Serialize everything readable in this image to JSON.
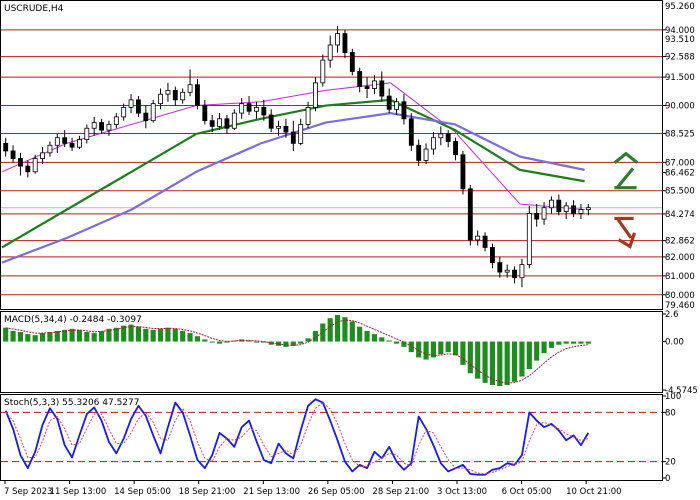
{
  "chart_data": [
    {
      "type": "candlestick",
      "title": "USCRUDE,H4",
      "x_tick_labels": [
        "7 Sep 2023",
        "11 Sep 13:00",
        "14 Sep 05:00",
        "18 Sep 21:00",
        "21 Sep 13:00",
        "26 Sep 05:00",
        "28 Sep 21:00",
        "3 Oct 13:00",
        "6 Oct 05:00",
        "10 Oct 21:00"
      ],
      "y_tick_labels": [
        "95.260",
        "93.510",
        "79.460"
      ],
      "ylim": [
        79.46,
        95.26
      ],
      "levels": [
        {
          "label": "94.000",
          "value": 94.0
        },
        {
          "label": "92.588",
          "value": 92.588
        },
        {
          "label": "91.500",
          "value": 91.5
        },
        {
          "label": "90.000",
          "value": 90.0
        },
        {
          "label": "88.525",
          "value": 88.525
        },
        {
          "label": "87.000",
          "value": 87.0
        },
        {
          "label": "86.462",
          "value": 86.462
        },
        {
          "label": "85.500",
          "value": 85.5
        },
        {
          "label": "84.274",
          "value": 84.274
        },
        {
          "label": "82.862",
          "value": 82.862
        },
        {
          "label": "82.000",
          "value": 82.0
        },
        {
          "label": "81.000",
          "value": 81.0
        },
        {
          "label": "80.000",
          "value": 80.0
        }
      ],
      "current_price": 84.6,
      "candles_ohlc": [
        [
          88.0,
          88.3,
          87.3,
          87.6
        ],
        [
          87.6,
          87.9,
          87.0,
          87.2
        ],
        [
          87.2,
          87.5,
          86.3,
          86.8
        ],
        [
          86.8,
          87.1,
          86.2,
          86.5
        ],
        [
          86.5,
          87.4,
          86.4,
          87.2
        ],
        [
          87.2,
          87.8,
          86.9,
          87.5
        ],
        [
          87.5,
          88.1,
          87.3,
          87.9
        ],
        [
          87.9,
          88.5,
          87.5,
          88.3
        ],
        [
          88.3,
          88.7,
          87.8,
          88.0
        ],
        [
          88.0,
          88.3,
          87.6,
          87.8
        ],
        [
          87.8,
          88.4,
          87.7,
          88.2
        ],
        [
          88.2,
          89.0,
          88.0,
          88.8
        ],
        [
          88.8,
          89.4,
          88.4,
          89.1
        ],
        [
          89.1,
          89.3,
          88.5,
          88.7
        ],
        [
          88.7,
          89.2,
          88.4,
          89.0
        ],
        [
          89.0,
          89.6,
          88.8,
          89.4
        ],
        [
          89.4,
          90.1,
          89.2,
          89.9
        ],
        [
          89.9,
          90.6,
          89.6,
          90.3
        ],
        [
          90.3,
          90.5,
          89.4,
          89.6
        ],
        [
          89.6,
          90.0,
          88.8,
          89.2
        ],
        [
          89.2,
          90.3,
          89.1,
          90.1
        ],
        [
          90.1,
          90.9,
          89.8,
          90.6
        ],
        [
          90.6,
          91.2,
          90.2,
          90.8
        ],
        [
          90.8,
          91.0,
          90.0,
          90.3
        ],
        [
          90.3,
          90.9,
          90.1,
          90.7
        ],
        [
          90.7,
          91.9,
          90.5,
          91.1
        ],
        [
          91.1,
          91.4,
          89.8,
          90.0
        ],
        [
          90.0,
          90.3,
          89.0,
          89.2
        ],
        [
          89.2,
          89.5,
          88.6,
          88.9
        ],
        [
          88.9,
          89.6,
          88.7,
          89.3
        ],
        [
          89.3,
          89.5,
          88.5,
          88.8
        ],
        [
          88.8,
          89.8,
          88.7,
          89.6
        ],
        [
          89.6,
          90.4,
          89.3,
          90.1
        ],
        [
          90.1,
          90.5,
          89.5,
          89.7
        ],
        [
          89.7,
          90.2,
          89.3,
          89.9
        ],
        [
          89.9,
          90.3,
          89.2,
          89.5
        ],
        [
          89.5,
          89.8,
          88.6,
          88.8
        ],
        [
          88.8,
          89.2,
          88.4,
          88.9
        ],
        [
          88.9,
          89.3,
          88.3,
          88.6
        ],
        [
          88.6,
          89.2,
          87.6,
          88.0
        ],
        [
          88.0,
          89.3,
          87.9,
          89.0
        ],
        [
          89.0,
          90.2,
          88.8,
          89.9
        ],
        [
          89.9,
          91.5,
          89.7,
          91.2
        ],
        [
          91.2,
          92.7,
          91.0,
          92.4
        ],
        [
          92.4,
          93.7,
          92.0,
          93.2
        ],
        [
          93.2,
          94.2,
          92.8,
          93.8
        ],
        [
          93.8,
          94.0,
          92.5,
          92.8
        ],
        [
          92.8,
          93.0,
          91.6,
          91.8
        ],
        [
          91.8,
          92.0,
          90.7,
          91.0
        ],
        [
          91.0,
          91.5,
          90.4,
          90.9
        ],
        [
          90.9,
          91.6,
          90.6,
          91.3
        ],
        [
          91.3,
          91.8,
          90.2,
          90.5
        ],
        [
          90.5,
          90.9,
          89.6,
          89.8
        ],
        [
          89.8,
          90.4,
          89.5,
          90.2
        ],
        [
          90.2,
          90.6,
          89.0,
          89.3
        ],
        [
          89.3,
          89.6,
          87.6,
          87.9
        ],
        [
          87.9,
          88.2,
          86.8,
          87.1
        ],
        [
          87.1,
          88.0,
          86.9,
          87.7
        ],
        [
          87.7,
          88.6,
          87.4,
          88.3
        ],
        [
          88.3,
          88.9,
          87.9,
          88.5
        ],
        [
          88.5,
          88.7,
          87.8,
          88.1
        ],
        [
          88.1,
          88.3,
          87.1,
          87.4
        ],
        [
          87.4,
          87.6,
          85.3,
          85.6
        ],
        [
          85.6,
          85.8,
          82.6,
          82.9
        ],
        [
          82.9,
          83.4,
          82.6,
          83.1
        ],
        [
          83.1,
          83.3,
          82.3,
          82.5
        ],
        [
          82.5,
          82.7,
          81.4,
          81.7
        ],
        [
          81.7,
          82.0,
          80.9,
          81.2
        ],
        [
          81.2,
          81.6,
          80.9,
          81.3
        ],
        [
          81.3,
          81.5,
          80.6,
          80.9
        ],
        [
          80.9,
          81.9,
          80.4,
          81.6
        ],
        [
          81.6,
          84.7,
          81.4,
          84.3
        ],
        [
          84.3,
          84.8,
          83.6,
          84.0
        ],
        [
          84.0,
          84.9,
          83.7,
          84.6
        ],
        [
          84.6,
          85.2,
          84.3,
          85.0
        ],
        [
          85.0,
          85.3,
          84.2,
          84.4
        ],
        [
          84.4,
          84.9,
          84.0,
          84.7
        ],
        [
          84.7,
          85.0,
          84.1,
          84.3
        ],
        [
          84.3,
          84.8,
          84.0,
          84.5
        ],
        [
          84.5,
          84.8,
          84.2,
          84.6
        ]
      ],
      "moving_averages": [
        {
          "color": "#c42bd9",
          "values_at_x_ticks": [
            86.5,
            88.0,
            89.0,
            90.0,
            90.2,
            90.8,
            91.2,
            88.6,
            84.8,
            84.5
          ]
        },
        {
          "color": "#1f7d1f",
          "values_at_x_ticks": [
            82.5,
            84.5,
            86.5,
            88.5,
            89.3,
            90.0,
            90.3,
            88.7,
            86.6,
            86.0
          ]
        },
        {
          "color": "#7b6fd6",
          "values_at_x_ticks": [
            81.7,
            83.0,
            84.5,
            86.5,
            88.0,
            89.1,
            89.6,
            89.0,
            87.3,
            86.6
          ]
        }
      ],
      "annotations": [
        {
          "label": "up-arrow",
          "color": "#2e7d32",
          "value": 86.4
        },
        {
          "label": "down-arrow",
          "color": "#a0391f",
          "value": 83.4
        }
      ]
    },
    {
      "type": "histogram",
      "title": "MACD(5,34,4) -0.2484 -0.3097",
      "y_tick_labels": [
        "2.6",
        "0.00",
        "-4.5745"
      ],
      "ylim": [
        -4.5745,
        2.6
      ],
      "bars": [
        1.3,
        1.0,
        0.9,
        0.7,
        0.6,
        0.8,
        0.9,
        1.0,
        1.1,
        1.2,
        1.1,
        0.9,
        0.8,
        1.0,
        1.2,
        1.3,
        1.5,
        1.6,
        1.4,
        1.2,
        1.1,
        1.2,
        1.3,
        1.2,
        1.0,
        0.8,
        0.5,
        0.2,
        -0.1,
        -0.2,
        -0.1,
        0.1,
        0.2,
        0.1,
        0.0,
        -0.1,
        -0.3,
        -0.4,
        -0.5,
        -0.4,
        -0.2,
        0.3,
        1.0,
        1.7,
        2.2,
        2.5,
        2.3,
        1.9,
        1.4,
        1.0,
        0.7,
        0.4,
        0.1,
        -0.2,
        -0.5,
        -1.0,
        -1.5,
        -1.7,
        -1.5,
        -1.2,
        -1.0,
        -1.3,
        -2.2,
        -3.0,
        -3.5,
        -3.9,
        -4.1,
        -4.2,
        -4.1,
        -3.8,
        -3.3,
        -2.6,
        -1.8,
        -1.1,
        -0.6,
        -0.3,
        -0.2,
        -0.2,
        -0.2,
        -0.2
      ],
      "signal_line_color": "#a01b3a"
    },
    {
      "type": "line",
      "title": "Stoch(5,3,3) 55.3206 47.5277",
      "y_tick_labels": [
        "100",
        "80",
        "20",
        "0"
      ],
      "ylim": [
        0,
        100
      ],
      "levels": [
        80,
        20
      ],
      "series": [
        {
          "color": "#1a1ae6",
          "values": [
            82,
            60,
            28,
            12,
            32,
            65,
            85,
            72,
            40,
            25,
            52,
            78,
            86,
            70,
            44,
            30,
            48,
            72,
            88,
            76,
            52,
            30,
            62,
            92,
            80,
            52,
            22,
            12,
            28,
            55,
            48,
            38,
            62,
            70,
            45,
            22,
            18,
            42,
            30,
            24,
            58,
            88,
            96,
            92,
            70,
            46,
            20,
            8,
            16,
            12,
            32,
            24,
            38,
            20,
            10,
            18,
            75,
            60,
            40,
            18,
            8,
            12,
            16,
            5,
            4,
            4,
            10,
            12,
            18,
            16,
            28,
            80,
            70,
            62,
            66,
            58,
            46,
            52,
            40,
            55
          ]
        },
        {
          "color": "#e0425c",
          "values": [
            80,
            70,
            48,
            25,
            25,
            45,
            70,
            75,
            60,
            40,
            42,
            60,
            78,
            78,
            60,
            42,
            42,
            55,
            72,
            80,
            68,
            48,
            46,
            70,
            85,
            70,
            44,
            24,
            20,
            38,
            48,
            46,
            50,
            60,
            58,
            40,
            26,
            30,
            34,
            28,
            40,
            65,
            85,
            92,
            84,
            66,
            42,
            22,
            14,
            14,
            20,
            24,
            30,
            28,
            18,
            15,
            40,
            58,
            55,
            38,
            22,
            12,
            12,
            10,
            6,
            5,
            7,
            10,
            14,
            16,
            20,
            45,
            65,
            68,
            64,
            60,
            54,
            50,
            46,
            48
          ]
        }
      ]
    }
  ]
}
